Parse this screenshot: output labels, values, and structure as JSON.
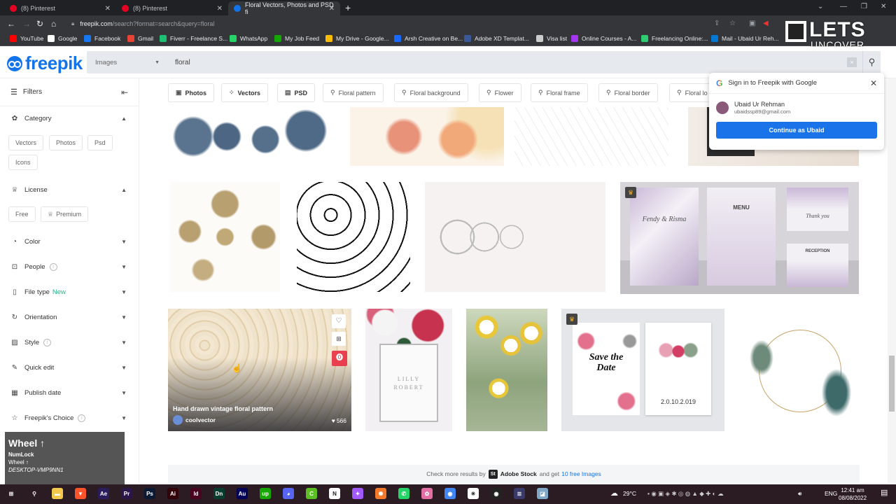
{
  "browser": {
    "tabs": [
      {
        "title": "(8) Pinterest",
        "active": false,
        "favicon_color": "#e60023"
      },
      {
        "title": "(8) Pinterest",
        "active": false,
        "favicon_color": "#e60023"
      },
      {
        "title": "Floral Vectors, Photos and PSD fi",
        "active": true,
        "favicon_color": "#1273eb"
      }
    ],
    "new_tab": "+",
    "url_host": "freepik.com",
    "url_path": "/search?format=search&query=floral",
    "bookmarks": [
      {
        "label": "YouTube",
        "color": "#ff0000"
      },
      {
        "label": "Google",
        "color": "#ffffff"
      },
      {
        "label": "Facebook",
        "color": "#1877f2"
      },
      {
        "label": "Gmail",
        "color": "#ea4335"
      },
      {
        "label": "Fiverr - Freelance S...",
        "color": "#1dbf73"
      },
      {
        "label": "WhatsApp",
        "color": "#25d366"
      },
      {
        "label": "My Job Feed",
        "color": "#14a800"
      },
      {
        "label": "My Drive - Google...",
        "color": "#fbbc05"
      },
      {
        "label": "Arsh Creative on Be...",
        "color": "#1769ff"
      },
      {
        "label": "Adobe XD Templat...",
        "color": "#3b5998"
      },
      {
        "label": "Visa list",
        "color": "#cccccc"
      },
      {
        "label": "Online Courses - A...",
        "color": "#a435f0"
      },
      {
        "label": "Freelancing Online:...",
        "color": "#2ecc71"
      },
      {
        "label": "Mail - Ubaid Ur Reh...",
        "color": "#0078d4"
      }
    ]
  },
  "watermark": {
    "line1": "LETS",
    "line2": "UNCOVER"
  },
  "header": {
    "logo": "freepik",
    "search_type": "Images",
    "search_query": "floral",
    "clear_label": "×"
  },
  "sidebar": {
    "title": "Filters",
    "sections": [
      {
        "label": "Category",
        "icon": "category-icon",
        "expanded": true
      },
      {
        "label": "License",
        "icon": "crown-icon",
        "expanded": true
      },
      {
        "label": "Color",
        "icon": "palette-icon",
        "expanded": false
      },
      {
        "label": "People",
        "icon": "people-icon",
        "expanded": false,
        "info": true
      },
      {
        "label": "File type",
        "icon": "file-icon",
        "expanded": false,
        "badge": "New"
      },
      {
        "label": "Orientation",
        "icon": "rotate-icon",
        "expanded": false
      },
      {
        "label": "Style",
        "icon": "image-icon",
        "expanded": false,
        "info": true
      },
      {
        "label": "Quick edit",
        "icon": "brush-icon",
        "expanded": false
      },
      {
        "label": "Publish date",
        "icon": "calendar-icon",
        "expanded": false
      },
      {
        "label": "Freepik's Choice",
        "icon": "star-icon",
        "expanded": false,
        "info": true
      }
    ],
    "category_chips": [
      "Vectors",
      "Photos",
      "Psd",
      "Icons"
    ],
    "license_chips": [
      "Free",
      "Premium"
    ]
  },
  "osd": {
    "title": "Wheel ↑",
    "line1": "NumLock",
    "line2": "Wheel ↑",
    "line3": "DESKTOP-VMP9NN1"
  },
  "filter_chips": [
    {
      "label": "Photos",
      "type": "format"
    },
    {
      "label": "Vectors",
      "type": "format"
    },
    {
      "label": "PSD",
      "type": "format"
    },
    {
      "label": "Floral pattern",
      "type": "search"
    },
    {
      "label": "Floral background",
      "type": "search"
    },
    {
      "label": "Flower",
      "type": "search"
    },
    {
      "label": "Floral frame",
      "type": "search"
    },
    {
      "label": "Floral border",
      "type": "search"
    },
    {
      "label": "Floral lo",
      "type": "search"
    }
  ],
  "results": [
    {
      "desc": "Watercolor blue floral bouquets",
      "premium": false
    },
    {
      "desc": "Watercolor orange floral background",
      "premium": false
    },
    {
      "desc": "Line art flowers",
      "premium": false
    },
    {
      "desc": "Floral photo frame",
      "premium": false
    },
    {
      "desc": "Golden ornamental floral elements",
      "premium": false
    },
    {
      "desc": "Black swirl floral ornaments",
      "premium": false
    },
    {
      "desc": "Hand drawn floral frames and dividers",
      "premium": false
    },
    {
      "desc": "Purple floral wedding invitation set",
      "premium": true,
      "texts": [
        "Fendy & Risma",
        "MENU",
        "Thank you",
        "RECEPTION"
      ]
    },
    {
      "desc": "Hand drawn vintage floral pattern",
      "premium": false,
      "hovered": true,
      "title": "Hand drawn vintage floral pattern",
      "author": "coolvector",
      "likes": "566"
    },
    {
      "desc": "Floral wedding invitation photo",
      "premium": false,
      "texts": [
        "LILLY",
        "ROBERT"
      ]
    },
    {
      "desc": "Chamomile flowers photo",
      "premium": false
    },
    {
      "desc": "Save the date floral cards",
      "premium": true,
      "texts": [
        "Save the Date",
        "2.0.10.2.019"
      ]
    },
    {
      "desc": "Watercolor leaves golden ring wreath",
      "premium": false
    }
  ],
  "google_popup": {
    "title": "Sign in to Freepik with Google",
    "name": "Ubaid Ur Rehman",
    "email": "ubaidssp89@gmail.com",
    "button": "Continue as Ubaid"
  },
  "adobe_bar": {
    "prefix": "Check more results by",
    "logo": "St",
    "brand": "Adobe Stock",
    "middle": "and get",
    "link": "10 free Images"
  },
  "taskbar": {
    "apps": [
      "Windows",
      "Search",
      "File Explorer",
      "Brave",
      "After Effects",
      "Premiere Pro",
      "Photoshop",
      "Illustrator",
      "InDesign",
      "Dimension",
      "Audition",
      "Upwork",
      "Discord",
      "Camtasia",
      "Notion",
      "Figma",
      "Blender",
      "WhatsApp",
      "App",
      "Chrome",
      "Slack",
      "OBS",
      "App",
      "Notepad"
    ],
    "weather": "29°C",
    "lang": "ENG",
    "time": "12:41 am",
    "date": "08/08/2022",
    "notifications": "1"
  }
}
